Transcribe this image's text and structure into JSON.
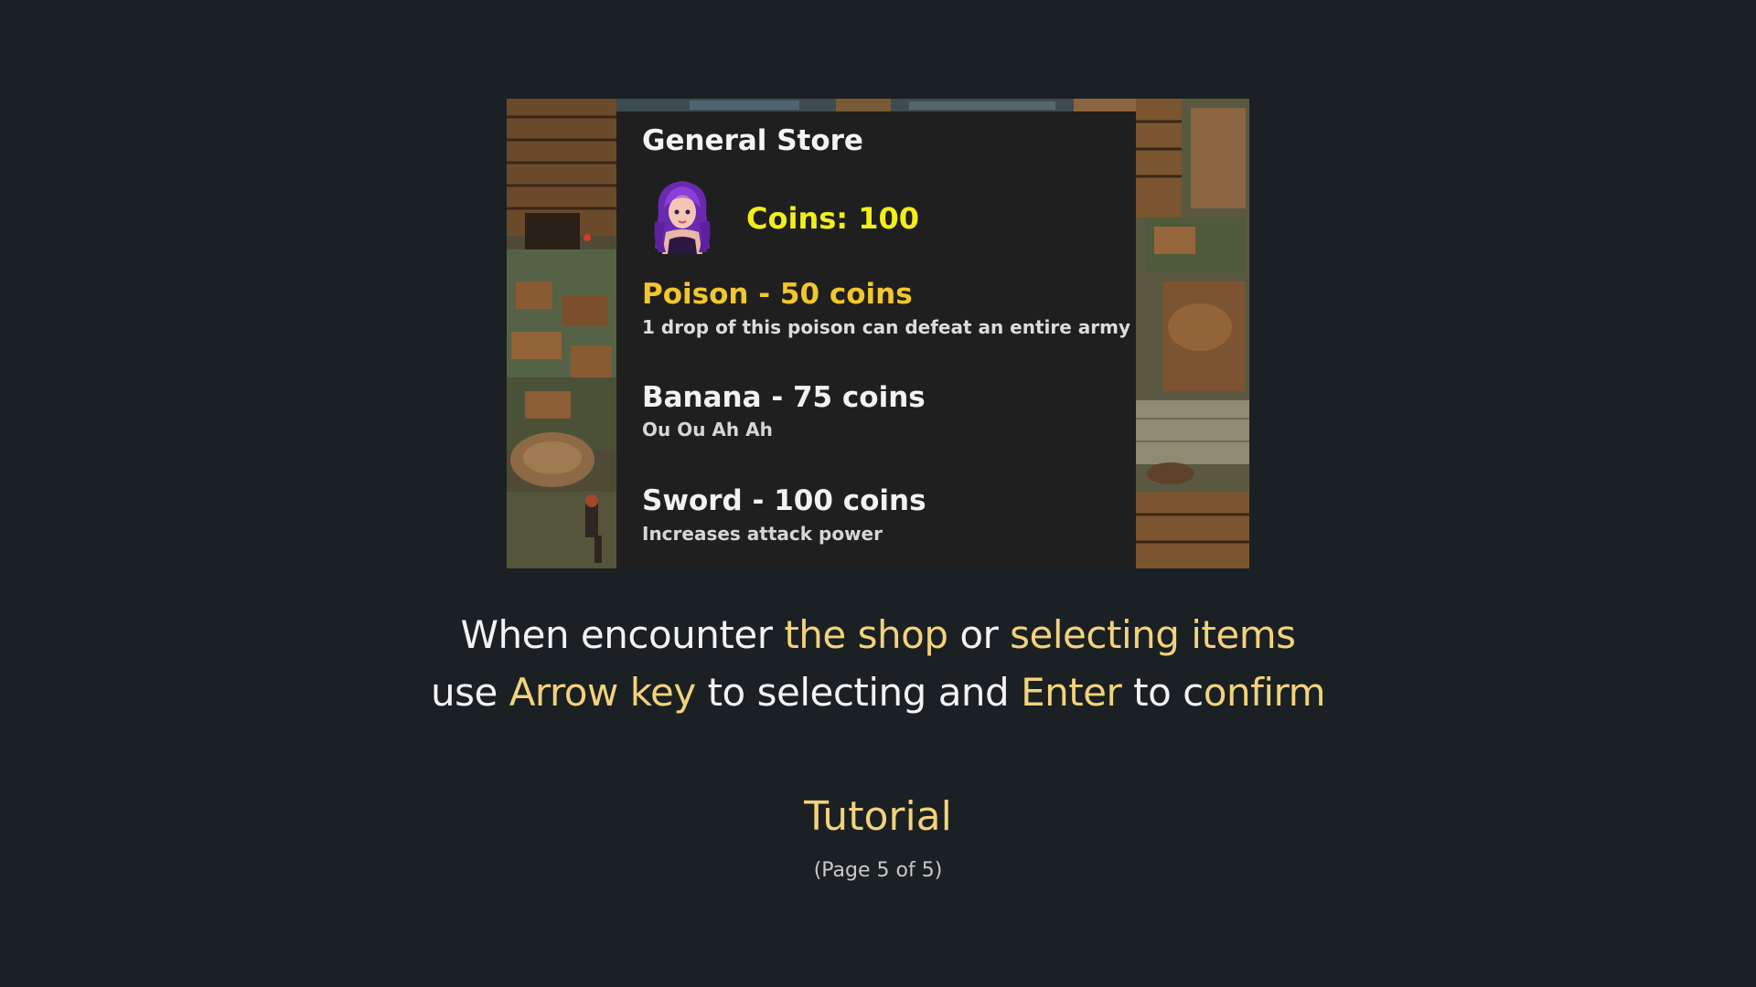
{
  "shop": {
    "title": "General Store",
    "coins": "Coins: 100",
    "items": [
      {
        "name": "Poison - 50 coins",
        "description": "1 drop of this poison can defeat an entire army",
        "selected": true
      },
      {
        "name": "Banana - 75 coins",
        "description": "Ou Ou Ah Ah",
        "selected": false
      },
      {
        "name": "Sword - 100 coins",
        "description": "Increases attack power",
        "selected": false
      }
    ]
  },
  "caption": {
    "line1": [
      {
        "text": "When encounter ",
        "highlight": false
      },
      {
        "text": "the shop",
        "highlight": true
      },
      {
        "text": " or ",
        "highlight": false
      },
      {
        "text": "selecting items",
        "highlight": true
      }
    ],
    "line2": [
      {
        "text": "use ",
        "highlight": false
      },
      {
        "text": "Arrow key",
        "highlight": true
      },
      {
        "text": " to selecting and ",
        "highlight": false
      },
      {
        "text": "Enter",
        "highlight": true
      },
      {
        "text": " to c",
        "highlight": false
      },
      {
        "text": "onfirm",
        "highlight": true
      }
    ]
  },
  "footer": {
    "title": "Tutorial",
    "page": "(Page 5 of 5)"
  },
  "colors": {
    "background": "#1a2023",
    "highlight": "#f3d27a",
    "selected_item": "#f2c72b",
    "coins": "#f2ee1a"
  }
}
